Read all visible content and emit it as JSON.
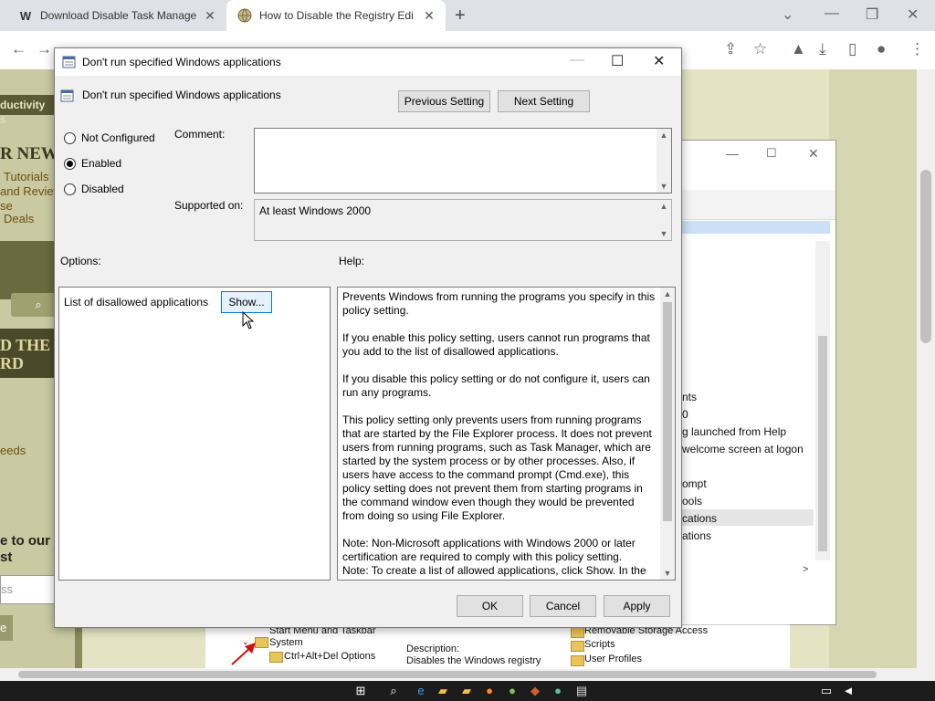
{
  "browser": {
    "tabs": [
      {
        "favicon": "W",
        "title": "Download Disable Task Manage"
      },
      {
        "favicon": "globe-icon",
        "title": "How to Disable the Registry Edi"
      }
    ]
  },
  "page": {
    "left": [
      "ductivity",
      "s",
      "R NEWS",
      "Tutorials",
      "and Review",
      "se",
      "Deals",
      "D THE",
      "RD",
      "eeds",
      "e to our",
      "st",
      "ss",
      "e"
    ]
  },
  "bg_window": {
    "rows": [
      "nts",
      "0",
      "g launched from Help",
      "welcome screen at logon",
      "ompt",
      "ools",
      "cations",
      "ations"
    ],
    "tree": [
      "Start Menu and Taskbar",
      "System",
      "Ctrl+Alt+Del Options"
    ],
    "description": [
      "Description:",
      "Disables the Windows registry"
    ],
    "right_items": [
      "Removable Storage Access",
      "Scripts",
      "User Profiles"
    ]
  },
  "dialog": {
    "title": "Don't run specified Windows applications",
    "setting_name": "Don't run specified Windows applications",
    "prev_button": "Previous Setting",
    "next_button": "Next Setting",
    "radios": [
      {
        "label": "Not Configured",
        "checked": false
      },
      {
        "label": "Enabled",
        "checked": true
      },
      {
        "label": "Disabled",
        "checked": false
      }
    ],
    "comment_label": "Comment:",
    "supported_label": "Supported on:",
    "supported_value": "At least Windows 2000",
    "options_label": "Options:",
    "help_label": "Help:",
    "option_item_label": "List of disallowed applications",
    "show_button": "Show...",
    "help_paragraphs": [
      "Prevents Windows from running the programs you specify in this policy setting.",
      "If you enable this policy setting, users cannot run programs that you add to the list of disallowed applications.",
      "If you disable this policy setting or do not configure it, users can run any programs.",
      "This policy setting only prevents users from running programs that are started by the File Explorer process. It does not prevent users from running programs, such as Task Manager, which are started by the system process or by other processes.  Also, if users have access to the command prompt (Cmd.exe), this policy setting does not prevent them from starting programs in the command window even though they would be prevented from doing so using File Explorer.",
      "Note: Non-Microsoft applications with Windows 2000 or later certification are required to comply with this policy setting.",
      "Note: To create a list of allowed applications, click Show.  In the"
    ],
    "ok_button": "OK",
    "cancel_button": "Cancel",
    "apply_button": "Apply"
  }
}
